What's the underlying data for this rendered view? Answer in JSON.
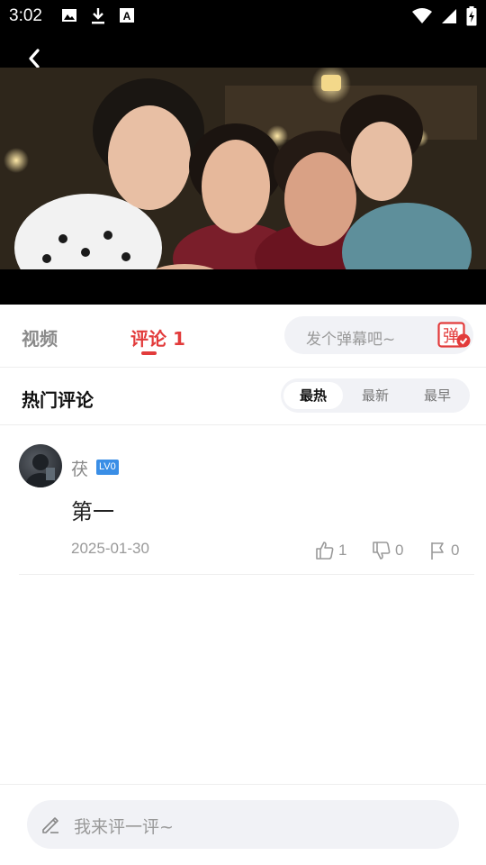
{
  "status_bar": {
    "time": "3:02",
    "left_icons": [
      "image-icon",
      "download-icon",
      "font-icon"
    ],
    "right_icons": [
      "wifi-icon",
      "signal-icon",
      "battery-icon"
    ]
  },
  "player": {
    "back_icon": "chevron-left-icon"
  },
  "tabs": {
    "video_label": "视频",
    "comment_label": "评论 1"
  },
  "danmaku": {
    "placeholder": "发个弹幕吧~",
    "button_glyph": "弹"
  },
  "hot": {
    "title": "热门评论",
    "sort_options": [
      "最热",
      "最新",
      "最早"
    ],
    "active_sort": "最热"
  },
  "comments": [
    {
      "username": "茯",
      "level": "LV0",
      "text": "第一",
      "date": "2025-01-30",
      "likes": "1",
      "dislikes": "0",
      "reports": "0"
    }
  ],
  "bottom_input": {
    "placeholder": "我来评一评~"
  },
  "colors": {
    "accent": "#e23b3b",
    "level_badge": "#3a8ee6",
    "pill_bg": "#f1f2f6"
  }
}
